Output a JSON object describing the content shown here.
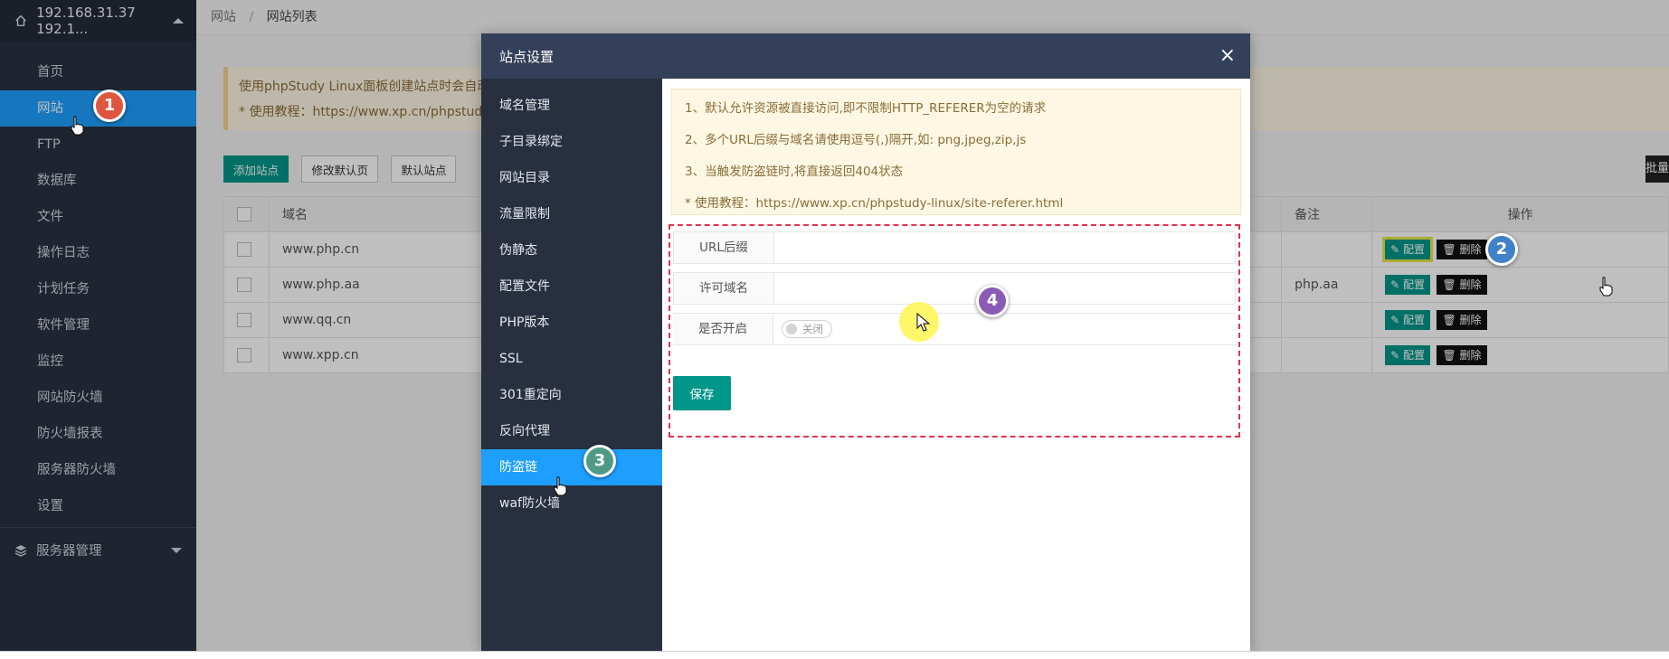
{
  "sidebar": {
    "server_label": "192.168.31.37 192.1...",
    "nav": [
      {
        "label": "首页"
      },
      {
        "label": "网站"
      },
      {
        "label": "FTP"
      },
      {
        "label": "数据库"
      },
      {
        "label": "文件"
      },
      {
        "label": "操作日志"
      },
      {
        "label": "计划任务"
      },
      {
        "label": "软件管理"
      },
      {
        "label": "监控"
      },
      {
        "label": "网站防火墙"
      },
      {
        "label": "防火墙报表"
      },
      {
        "label": "服务器防火墙"
      },
      {
        "label": "设置"
      }
    ],
    "active_index": 1,
    "bottom_label": "服务器管理"
  },
  "breadcrumb": {
    "root": "网站",
    "separator": "/",
    "current": "网站列表"
  },
  "main_tip": {
    "line1": "使用phpStudy Linux面板创建站点时会自动创",
    "line2": "* 使用教程：https://www.xp.cn/phpstudy-lin"
  },
  "toolbar": {
    "add_site": "添加站点",
    "edit_default": "修改默认页",
    "default_site": "默认站点",
    "batch": "批量"
  },
  "table": {
    "col_domain": "域名",
    "col_note": "备注",
    "col_ops": "操作",
    "rows": [
      {
        "domain": "www.php.cn",
        "note": ""
      },
      {
        "domain": "www.php.aa",
        "note": "php.aa"
      },
      {
        "domain": "www.qq.cn",
        "note": ""
      },
      {
        "domain": "www.xpp.cn",
        "note": ""
      }
    ],
    "config_label": "配置",
    "delete_label": "删除"
  },
  "modal": {
    "title": "站点设置",
    "close_glyph": "×",
    "menu": [
      {
        "label": "域名管理"
      },
      {
        "label": "子目录绑定"
      },
      {
        "label": "网站目录"
      },
      {
        "label": "流量限制"
      },
      {
        "label": "伪静态"
      },
      {
        "label": "配置文件"
      },
      {
        "label": "PHP版本"
      },
      {
        "label": "SSL"
      },
      {
        "label": "301重定向"
      },
      {
        "label": "反向代理"
      },
      {
        "label": "防盗链"
      },
      {
        "label": "waf防火墙"
      }
    ],
    "active_menu_index": 10,
    "tips": [
      "1、默认允许资源被直接访问,即不限制HTTP_REFERER为空的请求",
      "2、多个URL后缀与域名请使用逗号(,)隔开,如: png,jpeg,zip,js",
      "3、当触发防盗链时,将直接返回404状态",
      "* 使用教程：https://www.xp.cn/phpstudy-linux/site-referer.html"
    ],
    "form": {
      "url_suffix_label": "URL后缀",
      "url_suffix_value": "",
      "allowed_domain_label": "许可域名",
      "allowed_domain_value": "",
      "enable_label": "是否开启",
      "enable_switch_text": "关闭",
      "enable_on": false,
      "save_label": "保存"
    }
  },
  "markers": {
    "m1": {
      "label": "1",
      "color": "#e0553e"
    },
    "m2": {
      "label": "2",
      "color": "#3f82c8"
    },
    "m3": {
      "label": "3",
      "color": "#4f9a86"
    },
    "m4": {
      "label": "4",
      "color": "#8a5bb5"
    }
  },
  "colors": {
    "sidebar_bg": "#283040",
    "active_blue": "#1e9fff",
    "primary_green": "#009688",
    "modal_header": "#34405a",
    "dashed_red": "#e0334f"
  }
}
